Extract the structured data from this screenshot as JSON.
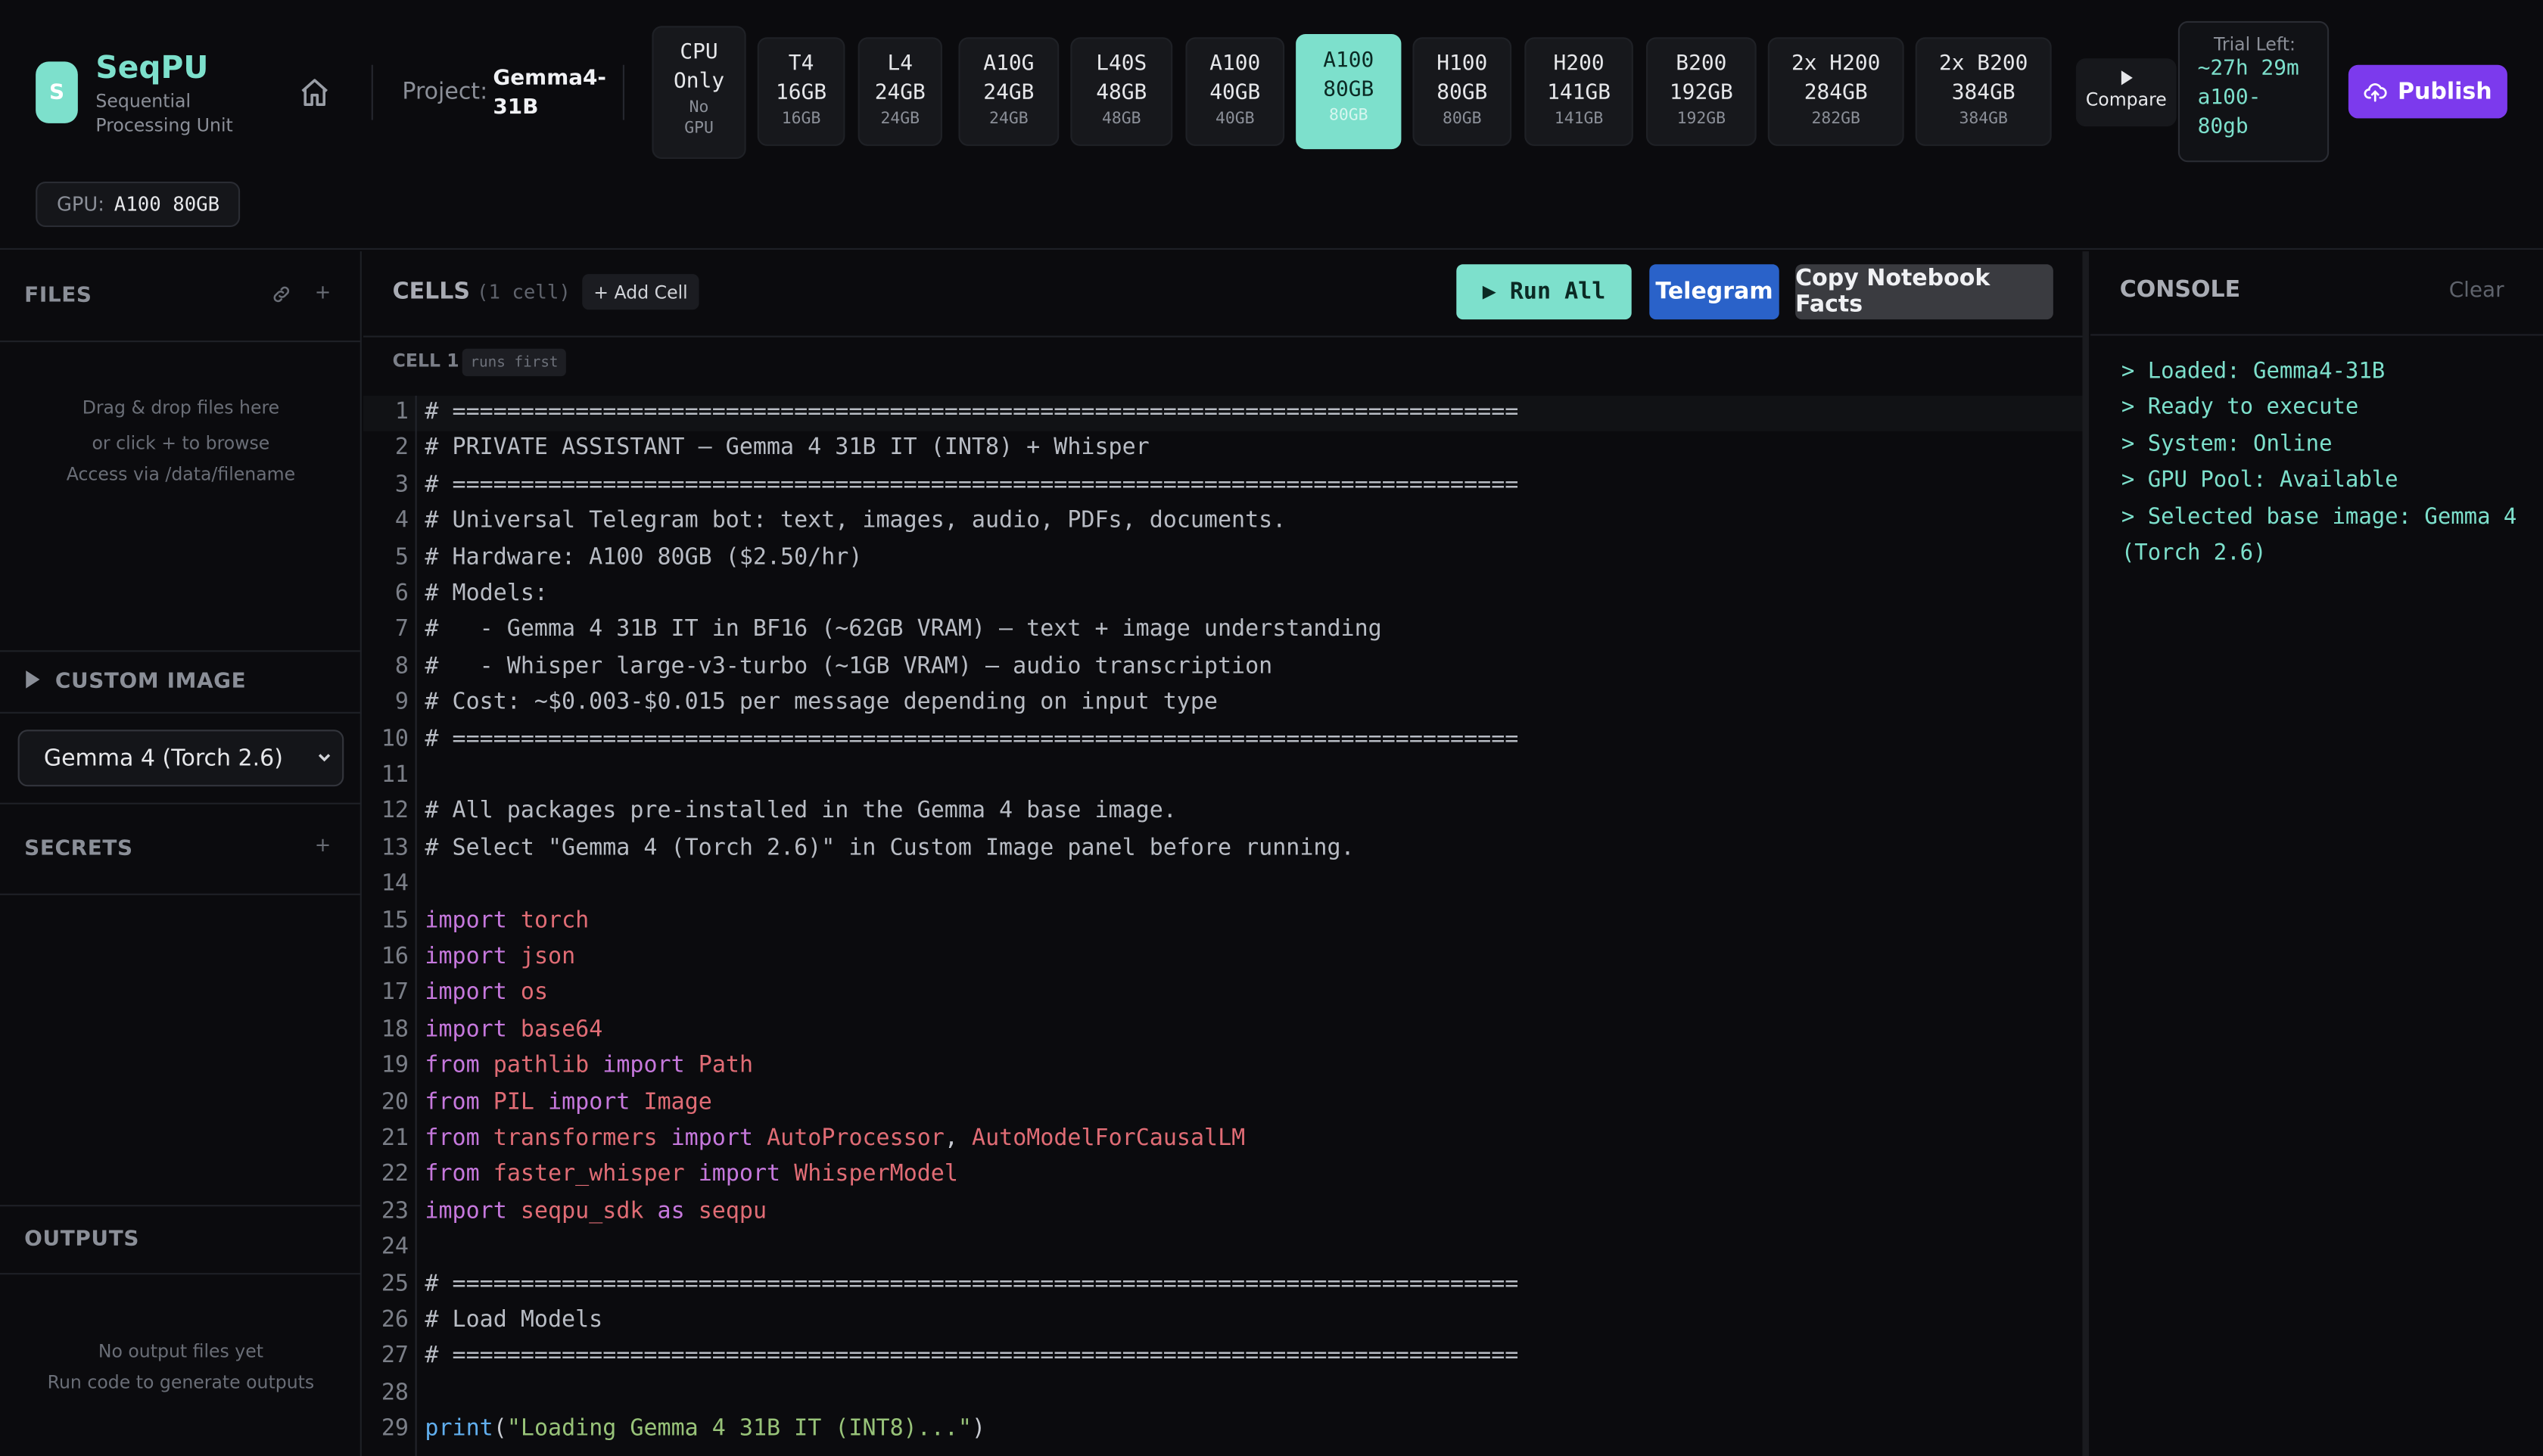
{
  "brand": {
    "logo_letter": "S",
    "name": "SeqPU",
    "subtitle": "Sequential Processing Unit"
  },
  "project": {
    "label": "Project:",
    "name": "Gemma4-31B"
  },
  "gpu_options": [
    {
      "line1": "CPU",
      "line2": "Only",
      "sub": "No GPU",
      "selected": false
    },
    {
      "line1": "T4",
      "line2": "16GB",
      "sub": "16GB",
      "selected": false
    },
    {
      "line1": "L4",
      "line2": "24GB",
      "sub": "24GB",
      "selected": false
    },
    {
      "line1": "A10G",
      "line2": "24GB",
      "sub": "24GB",
      "selected": false
    },
    {
      "line1": "L40S",
      "line2": "48GB",
      "sub": "48GB",
      "selected": false
    },
    {
      "line1": "A100",
      "line2": "40GB",
      "sub": "40GB",
      "selected": false
    },
    {
      "line1": "A100",
      "line2": "80GB",
      "sub": "80GB",
      "selected": true
    },
    {
      "line1": "H100",
      "line2": "80GB",
      "sub": "80GB",
      "selected": false
    },
    {
      "line1": "H200",
      "line2": "141GB",
      "sub": "141GB",
      "selected": false
    },
    {
      "line1": "B200",
      "line2": "192GB",
      "sub": "192GB",
      "selected": false
    },
    {
      "line1": "2x H200",
      "line2": "284GB",
      "sub": "282GB",
      "selected": false
    },
    {
      "line1": "2x B200",
      "line2": "384GB",
      "sub": "384GB",
      "selected": false
    }
  ],
  "compare": {
    "icon": "play-icon",
    "label": "Compare"
  },
  "trial": {
    "label": "Trial Left:",
    "time": "~27h 29m",
    "gpu_line1": "a100-",
    "gpu_line2": "80gb"
  },
  "publish": {
    "icon": "cloud-upload-icon",
    "label": "Publish"
  },
  "gpu_badge": {
    "label": "GPU:",
    "value": "A100 80GB"
  },
  "sidebar": {
    "files": {
      "title": "FILES",
      "icons": [
        "link-icon",
        "plus-icon"
      ],
      "drop_line1": "Drag & drop files here",
      "drop_line2": "or click + to browse",
      "drop_line3": "Access via /data/filename"
    },
    "custom_image": {
      "title": "CUSTOM IMAGE",
      "selected": "Gemma 4 (Torch 2.6)"
    },
    "secrets": {
      "title": "SECRETS",
      "add": "+"
    },
    "outputs": {
      "title": "OUTPUTS",
      "empty1": "No output files yet",
      "empty2": "Run code to generate outputs"
    }
  },
  "cells": {
    "title": "CELLS",
    "count": "(1 cell)",
    "add_label": "+ Add Cell",
    "run_all": "▶ Run All",
    "telegram": "Telegram",
    "copy_facts": "Copy Notebook Facts",
    "cell_label": "CELL 1",
    "cell_badge": "runs first"
  },
  "code_lines": [
    "# ==============================================================================",
    "# PRIVATE ASSISTANT — Gemma 4 31B IT (INT8) + Whisper",
    "# ==============================================================================",
    "# Universal Telegram bot: text, images, audio, PDFs, documents.",
    "# Hardware: A100 80GB ($2.50/hr)",
    "# Models:",
    "#   - Gemma 4 31B IT in BF16 (~62GB VRAM) — text + image understanding",
    "#   - Whisper large-v3-turbo (~1GB VRAM) — audio transcription",
    "# Cost: ~$0.003-$0.015 per message depending on input type",
    "# ==============================================================================",
    "",
    "# All packages pre-installed in the Gemma 4 base image.",
    "# Select \"Gemma 4 (Torch 2.6)\" in Custom Image panel before running.",
    "",
    "import torch",
    "import json",
    "import os",
    "import base64",
    "from pathlib import Path",
    "from PIL import Image",
    "from transformers import AutoProcessor, AutoModelForCausalLM",
    "from faster_whisper import WhisperModel",
    "import seqpu_sdk as seqpu",
    "",
    "# ==============================================================================",
    "# Load Models",
    "# ==============================================================================",
    "",
    "print(\"Loading Gemma 4 31B IT (INT8)...\")"
  ],
  "console": {
    "title": "CONSOLE",
    "clear": "Clear",
    "lines": [
      "> Loaded: Gemma4-31B",
      "> Ready to execute",
      "> System: Online",
      "> GPU Pool: Available",
      "> Selected base image: Gemma 4 (Torch 2.6)"
    ]
  },
  "colors": {
    "accent": "#7de0cc",
    "publish": "#7c3aed",
    "telegram": "#2a62c9",
    "background": "#0b0b0e"
  }
}
